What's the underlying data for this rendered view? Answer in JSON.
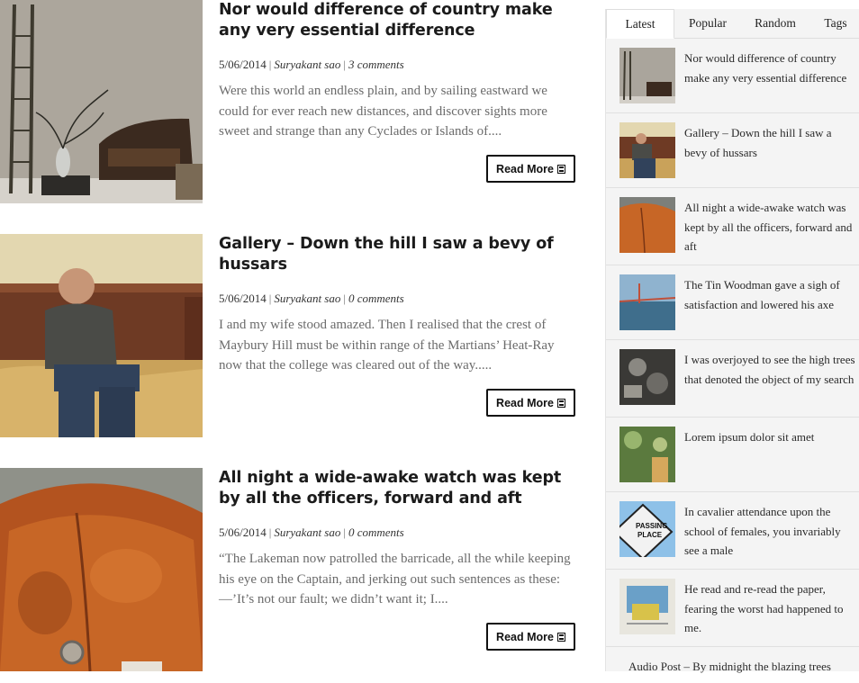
{
  "posts": [
    {
      "title": "Nor would difference of country make any very essential difference",
      "date": "5/06/2014",
      "author": "Suryakant sao",
      "comments": "3 comments",
      "excerpt": "Were this world an endless plain, and by sailing eastward we could for ever reach new distances, and discover sights more sweet and strange than any Cyclades or Islands of....",
      "read_more": "Read More",
      "image": "living-room-ladder-chair"
    },
    {
      "title": "Gallery – Down the hill I saw a bevy of hussars",
      "date": "5/06/2014",
      "author": "Suryakant sao",
      "comments": "0 comments",
      "excerpt": "I and my wife stood amazed. Then I realised that the crest of Maybury Hill must be within range of the Martians’ Heat-Ray now that the college was cleared out of the way.....",
      "read_more": "Read More",
      "image": "man-sitting-on-bed"
    },
    {
      "title": "All night a wide-awake watch was kept by all the officers, forward and aft",
      "date": "5/06/2014",
      "author": "Suryakant sao",
      "comments": "0 comments",
      "excerpt": "“The Lakeman now patrolled the barricade, all the while keeping his eye on the Captain, and jerking out such sentences as these: —’It’s not our fault; we didn’t want it; I....",
      "read_more": "Read More",
      "image": "rusty-orange-car"
    }
  ],
  "sidebar": {
    "tabs": [
      "Latest",
      "Popular",
      "Random",
      "Tags"
    ],
    "active_tab": "Latest",
    "items": [
      {
        "title": "Nor would difference of country make any very essential difference",
        "image": "living-room"
      },
      {
        "title": "Gallery – Down the hill I saw a bevy of hussars",
        "image": "man-on-bed"
      },
      {
        "title": "All night a wide-awake watch was kept by all the officers, forward and aft",
        "image": "rusty-car"
      },
      {
        "title": "The Tin Woodman gave a sigh of satisfaction and lowered his axe",
        "image": "bridge-sea"
      },
      {
        "title": "I was overjoyed to see the high trees that denoted the object of my search",
        "image": "machine-parts"
      },
      {
        "title": "Lorem ipsum dolor sit amet",
        "image": "bokeh-leaves"
      },
      {
        "title": "In cavalier attendance upon the school of females, you invariably see a male",
        "image": "passing-place-sign",
        "sign_text": "PASSING PLACE"
      },
      {
        "title": "He read and re-read the paper, fearing the worst had happened to me.",
        "image": "newspaper"
      },
      {
        "title": "Audio Post – By midnight the blazing trees",
        "image": ""
      }
    ]
  }
}
